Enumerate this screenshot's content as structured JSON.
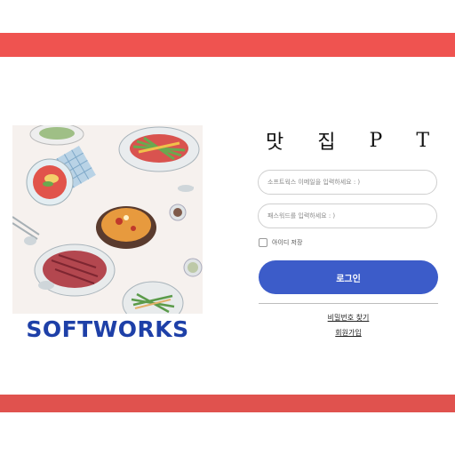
{
  "brand": {
    "logo_text": "SOFTWORKS",
    "accent_color": "#ef5350",
    "brand_blue": "#1e40a8"
  },
  "login": {
    "title_chars": [
      "맛",
      "집",
      "P",
      "T"
    ],
    "email_placeholder": "소프트웍스 이메일을 입력하세요 : )",
    "password_placeholder": "패스워드를 입력하세요 : )",
    "remember_label": "아이디 저장",
    "remember_checked": false,
    "submit_label": "로그인",
    "submit_color": "#3c5cc9",
    "find_password_link": "비밀번호 찾기",
    "signup_link": "회원가입"
  }
}
